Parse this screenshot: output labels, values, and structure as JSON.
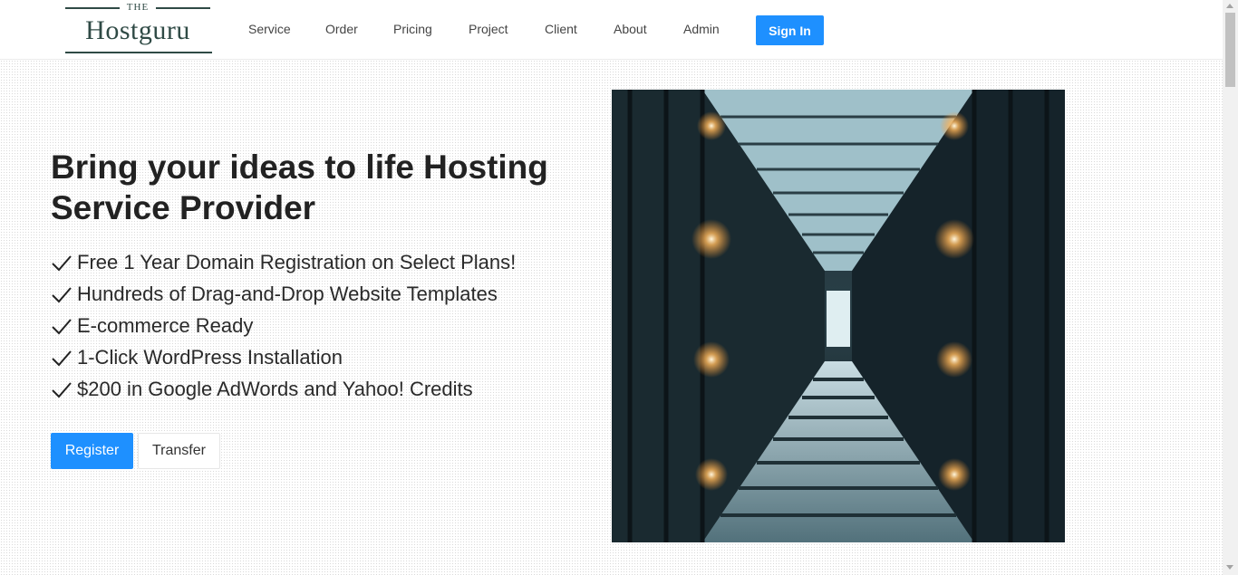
{
  "logo": {
    "the": "THE",
    "brand": "Hostguru"
  },
  "nav": {
    "links": [
      "Service",
      "Order",
      "Pricing",
      "Project",
      "Client",
      "About",
      "Admin"
    ],
    "signin_label": "Sign In"
  },
  "hero": {
    "title": "Bring your ideas to life Hosting Service Provider",
    "features": [
      "Free 1 Year Domain Registration on Select Plans!",
      "Hundreds of Drag-and-Drop Website Templates",
      "E-commerce Ready",
      "1-Click WordPress Installation",
      "$200 in Google AdWords and Yahoo! Credits"
    ],
    "register_label": "Register",
    "transfer_label": "Transfer"
  },
  "colors": {
    "accent": "#1e90ff",
    "logo": "#2f4a45"
  },
  "icons": {
    "feature_check": "check-icon",
    "hero_image": "server-corridor-image"
  }
}
